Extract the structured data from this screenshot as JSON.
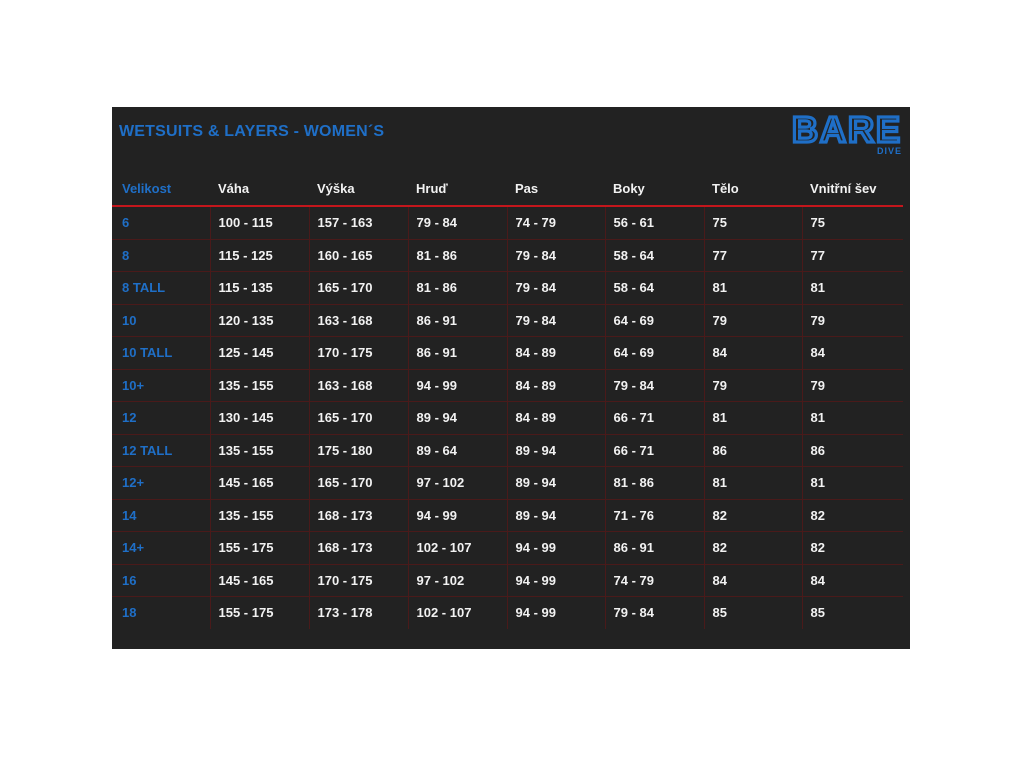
{
  "title": "WETSUITS & LAYERS - WOMEN´S",
  "logo": {
    "brand": "BARE",
    "sub": "DIVE",
    "color": "#1f6fc7"
  },
  "colors": {
    "background": "#222222",
    "accent_blue": "#1f6fc7",
    "divider_red": "#c4161c",
    "text": "#f2f2f2"
  },
  "table": {
    "headers": [
      "Velikost",
      "Váha",
      "Výška",
      "Hruď",
      "Pas",
      "Boky",
      "Tělo",
      "Vnitřní šev"
    ],
    "rows": [
      [
        "6",
        "100 - 115",
        "157 - 163",
        "79 - 84",
        "74 - 79",
        "56 - 61",
        "75",
        "75"
      ],
      [
        "8",
        "115 - 125",
        "160 - 165",
        "81 - 86",
        "79 - 84",
        "58 - 64",
        "77",
        "77"
      ],
      [
        "8 TALL",
        "115 - 135",
        "165 - 170",
        "81 - 86",
        "79 - 84",
        "58 - 64",
        "81",
        "81"
      ],
      [
        "10",
        "120 - 135",
        "163 - 168",
        "86 - 91",
        "79 - 84",
        "64 - 69",
        "79",
        "79"
      ],
      [
        "10 TALL",
        "125 - 145",
        "170 - 175",
        "86 - 91",
        "84 - 89",
        "64 - 69",
        "84",
        "84"
      ],
      [
        "10+",
        "135 - 155",
        "163 - 168",
        "94 - 99",
        "84 - 89",
        "79 - 84",
        "79",
        "79"
      ],
      [
        "12",
        "130 - 145",
        "165 - 170",
        "89 - 94",
        "84 - 89",
        "66 - 71",
        "81",
        "81"
      ],
      [
        "12 TALL",
        "135 - 155",
        "175 - 180",
        "89 - 64",
        "89 - 94",
        "66 - 71",
        "86",
        "86"
      ],
      [
        "12+",
        "145 - 165",
        "165 - 170",
        "97 - 102",
        "89 - 94",
        "81 - 86",
        "81",
        "81"
      ],
      [
        "14",
        "135 - 155",
        "168 - 173",
        "94 - 99",
        "89 - 94",
        "71 - 76",
        "82",
        "82"
      ],
      [
        "14+",
        "155 - 175",
        "168 - 173",
        "102 - 107",
        "94 - 99",
        "86 - 91",
        "82",
        "82"
      ],
      [
        "16",
        "145 - 165",
        "170 - 175",
        "97 - 102",
        "94 - 99",
        "74 - 79",
        "84",
        "84"
      ],
      [
        "18",
        "155 - 175",
        "173 - 178",
        "102 - 107",
        "94 - 99",
        "79 - 84",
        "85",
        "85"
      ]
    ]
  }
}
